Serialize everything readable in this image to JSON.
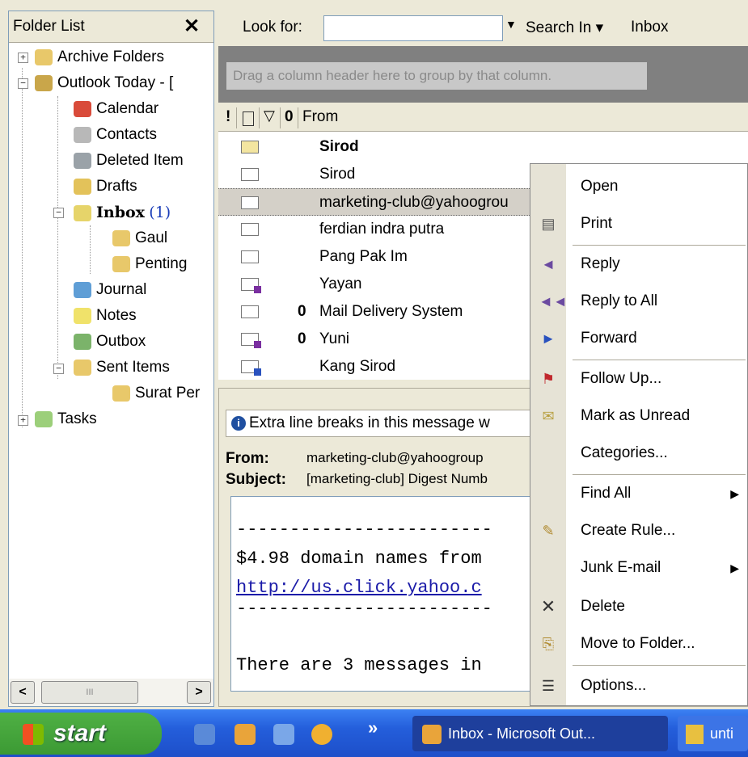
{
  "folder_list": {
    "title": "Folder List",
    "close": "✕",
    "items": [
      {
        "label": "Archive Folders",
        "count": ""
      },
      {
        "label": "Outlook Today - [",
        "count": ""
      },
      {
        "label": "Calendar",
        "count": ""
      },
      {
        "label": "Contacts",
        "count": ""
      },
      {
        "label": "Deleted Item",
        "count": ""
      },
      {
        "label": "Drafts",
        "count": ""
      },
      {
        "label": "Inbox",
        "count": "(1)"
      },
      {
        "label": "Gaul",
        "count": ""
      },
      {
        "label": "Penting",
        "count": ""
      },
      {
        "label": "Journal",
        "count": ""
      },
      {
        "label": "Notes",
        "count": ""
      },
      {
        "label": "Outbox",
        "count": ""
      },
      {
        "label": "Sent Items",
        "count": ""
      },
      {
        "label": "Surat Per",
        "count": ""
      },
      {
        "label": "Tasks",
        "count": ""
      }
    ],
    "scroll_left": "<",
    "scroll_right": ">",
    "scroll_grip": "III"
  },
  "search": {
    "look_for_label": "Look for:",
    "search_in_label": "Search In ▾",
    "search_in_value": "Inbox"
  },
  "group_hint": "Drag a column header here to group by that column.",
  "columns": {
    "importance": "!",
    "from": "From"
  },
  "messages": [
    {
      "from": "Sirod",
      "unread": true,
      "attach": "",
      "state": "unread"
    },
    {
      "from": "Sirod",
      "unread": false,
      "attach": "",
      "state": "read"
    },
    {
      "from": "marketing-club@yahoogrou",
      "unread": false,
      "attach": "",
      "state": "read"
    },
    {
      "from": "ferdian indra putra",
      "unread": false,
      "attach": "",
      "state": "read"
    },
    {
      "from": "Pang Pak Im",
      "unread": false,
      "attach": "",
      "state": "read"
    },
    {
      "from": "Yayan",
      "unread": false,
      "attach": "",
      "state": "replied"
    },
    {
      "from": "Mail Delivery System",
      "unread": false,
      "attach": "0",
      "state": "read"
    },
    {
      "from": "Yuni",
      "unread": false,
      "attach": "0",
      "state": "replied"
    },
    {
      "from": "Kang Sirod",
      "unread": false,
      "attach": "",
      "state": "forwarded"
    }
  ],
  "reading": {
    "info": "Extra line breaks in this message w",
    "from_label": "From:",
    "from_value": "marketing-club@yahoogroup",
    "subject_label": "Subject:",
    "subject_value": "[marketing-club] Digest Numb",
    "body_lines": [
      "------------------------",
      "$4.98 domain names from",
      "http://us.click.yahoo.c",
      "------------------------",
      "There are 3 messages in"
    ]
  },
  "context_menu": {
    "items": [
      {
        "label": "Open",
        "icon": ""
      },
      {
        "label": "Print",
        "icon": "printer-icon"
      },
      {
        "label": "Reply",
        "icon": "reply-icon"
      },
      {
        "label": "Reply to All",
        "icon": "reply-all-icon"
      },
      {
        "label": "Forward",
        "icon": "forward-icon"
      },
      {
        "label": "Follow Up...",
        "icon": "flag-icon"
      },
      {
        "label": "Mark as Unread",
        "icon": "envelope-icon"
      },
      {
        "label": "Categories...",
        "icon": ""
      },
      {
        "label": "Find All",
        "icon": "",
        "submenu": true
      },
      {
        "label": "Create Rule...",
        "icon": "rule-icon"
      },
      {
        "label": "Junk E-mail",
        "icon": "",
        "submenu": true
      },
      {
        "label": "Delete",
        "icon": "delete-icon"
      },
      {
        "label": "Move to Folder...",
        "icon": "move-folder-icon"
      },
      {
        "label": "Options...",
        "icon": "options-icon"
      }
    ]
  },
  "taskbar": {
    "start_label": "start",
    "overflow": "»",
    "tasks": [
      {
        "label": "Inbox - Microsoft Out..."
      },
      {
        "label": "unti"
      }
    ]
  }
}
